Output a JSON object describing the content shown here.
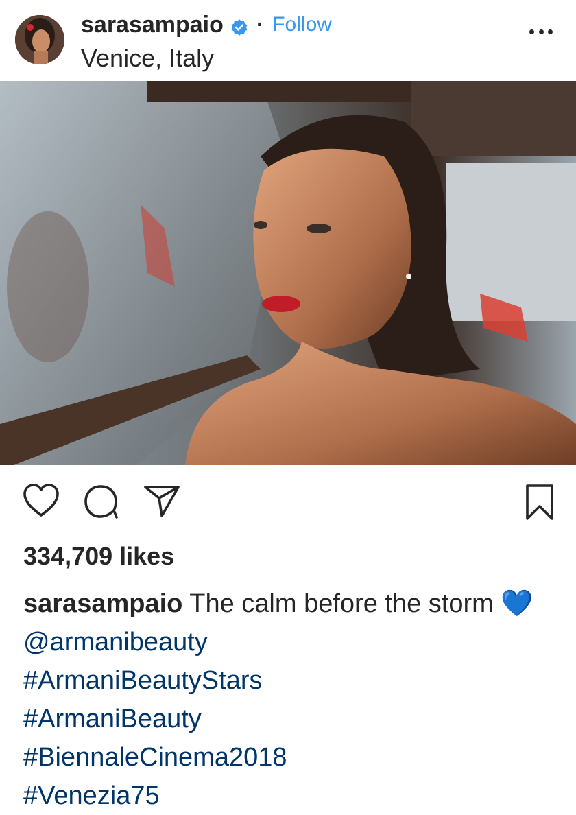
{
  "post": {
    "username": "sarasampaio",
    "separator": "·",
    "follow_label": "Follow",
    "location": "Venice, Italy",
    "likes": "334,709 likes",
    "caption_user": "sarasampaio",
    "caption_text_1": "The calm before the storm",
    "emoji": "💙",
    "mention": "@armanibeauty",
    "hashtags": [
      "#ArmaniBeautyStars",
      "#ArmaniBeauty",
      "#BiennaleCinema2018",
      "#Venezia75"
    ]
  },
  "icons": {
    "verified": "verified-badge-icon",
    "more": "more-options-icon",
    "like": "heart-icon",
    "comment": "comment-bubble-icon",
    "share": "paper-plane-icon",
    "save": "bookmark-icon"
  },
  "colors": {
    "link": "#3897f0",
    "hashtag": "#003569",
    "text": "#262626"
  }
}
